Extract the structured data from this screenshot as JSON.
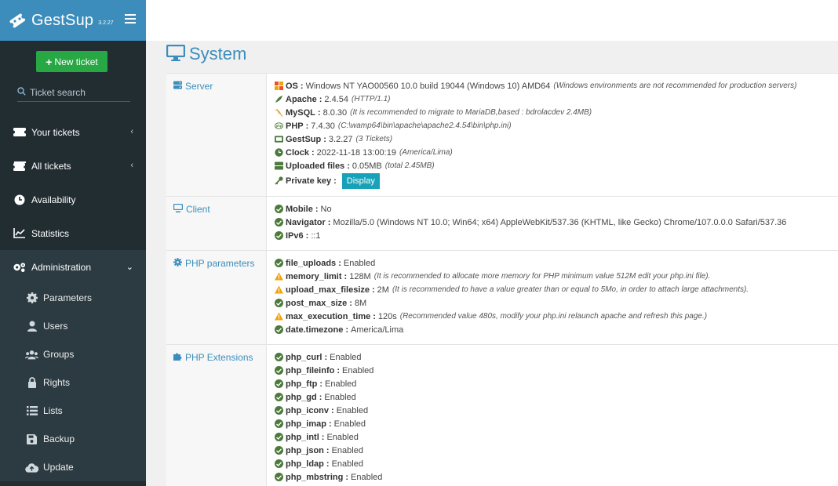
{
  "brand": {
    "name": "GestSup",
    "version": "3.2.27"
  },
  "sidebar": {
    "new_ticket": "New ticket",
    "search_placeholder": "Ticket search",
    "items": [
      {
        "label": "Your tickets",
        "icon": "ticket-icon",
        "chevron": "‹"
      },
      {
        "label": "All tickets",
        "icon": "tickets-icon",
        "chevron": "‹"
      },
      {
        "label": "Availability",
        "icon": "clock-icon"
      },
      {
        "label": "Statistics",
        "icon": "chart-icon"
      },
      {
        "label": "Administration",
        "icon": "cogs-icon",
        "chevron": "⌄"
      }
    ],
    "subitems": [
      {
        "label": "Parameters",
        "icon": "gear-icon"
      },
      {
        "label": "Users",
        "icon": "user-icon"
      },
      {
        "label": "Groups",
        "icon": "users-icon"
      },
      {
        "label": "Rights",
        "icon": "lock-icon"
      },
      {
        "label": "Lists",
        "icon": "list-icon"
      },
      {
        "label": "Backup",
        "icon": "save-icon"
      },
      {
        "label": "Update",
        "icon": "cloud-upload-icon"
      }
    ]
  },
  "page": {
    "title": "System"
  },
  "sections": {
    "server": {
      "label": "Server",
      "lines": [
        {
          "key": "OS",
          "value": "Windows NT YAO00560 10.0 build 19044 (Windows 10) AMD64",
          "note": "(Windows environments are not recommended for production servers)",
          "icon": "windows-icon"
        },
        {
          "key": "Apache",
          "value": "2.4.54",
          "note": "(HTTP/1.1)",
          "icon": "feather-icon"
        },
        {
          "key": "MySQL",
          "value": "8.0.30",
          "note": "(It is recommended to migrate to MariaDB,based : bdrolacdev 2.4MB)",
          "icon": "mysql-icon"
        },
        {
          "key": "PHP",
          "value": "7.4.30",
          "note": "(C:\\wamp64\\bin\\apache\\apache2.4.54\\bin\\php.ini)",
          "icon": "php-icon"
        },
        {
          "key": "GestSup",
          "value": "3.2.27",
          "note": "(3 Tickets)",
          "icon": "ticket-icon"
        },
        {
          "key": "Clock",
          "value": "2022-11-18 13:00:19",
          "note": "(America/Lima)",
          "icon": "clock-icon"
        },
        {
          "key": "Uploaded files",
          "value": "0.05MB",
          "note": "(total 2.45MB)",
          "icon": "hdd-icon"
        },
        {
          "key": "Private key",
          "value": "",
          "note": "",
          "icon": "key-icon",
          "button": "Display"
        }
      ]
    },
    "client": {
      "label": "Client",
      "lines": [
        {
          "key": "Mobile",
          "value": "No"
        },
        {
          "key": "Navigator",
          "value": "Mozilla/5.0 (Windows NT 10.0; Win64; x64) AppleWebKit/537.36 (KHTML, like Gecko) Chrome/107.0.0.0 Safari/537.36"
        },
        {
          "key": "IPv6",
          "value": "::1"
        }
      ]
    },
    "php_params": {
      "label": "PHP parameters",
      "lines": [
        {
          "key": "file_uploads",
          "value": "Enabled",
          "status": "ok",
          "note": ""
        },
        {
          "key": "memory_limit",
          "value": "128M",
          "status": "warn",
          "note": "(It is recommended to allocate more memory for PHP minimum value 512M edit your php.ini file)."
        },
        {
          "key": "upload_max_filesize",
          "value": "2M",
          "status": "warn",
          "note": "(It is recommended to have a value greater than or equal to 5Mo, in order to attach large attachments)."
        },
        {
          "key": "post_max_size",
          "value": "8M",
          "status": "ok",
          "note": ""
        },
        {
          "key": "max_execution_time",
          "value": "120s",
          "status": "warn",
          "note": "(Recommended value 480s, modify your php.ini relaunch apache and refresh this page.)"
        },
        {
          "key": "date.timezone",
          "value": "America/Lima",
          "status": "ok",
          "note": ""
        }
      ]
    },
    "php_ext": {
      "label": "PHP Extensions",
      "lines": [
        {
          "key": "php_curl",
          "value": "Enabled"
        },
        {
          "key": "php_fileinfo",
          "value": "Enabled"
        },
        {
          "key": "php_ftp",
          "value": "Enabled"
        },
        {
          "key": "php_gd",
          "value": "Enabled"
        },
        {
          "key": "php_iconv",
          "value": "Enabled"
        },
        {
          "key": "php_imap",
          "value": "Enabled"
        },
        {
          "key": "php_intl",
          "value": "Enabled"
        },
        {
          "key": "php_json",
          "value": "Enabled"
        },
        {
          "key": "php_ldap",
          "value": "Enabled"
        },
        {
          "key": "php_mbstring",
          "value": "Enabled"
        }
      ]
    }
  },
  "colors": {
    "accent": "#3c8dbc",
    "sidebar": "#222d32",
    "success": "#28a745",
    "ok": "#4b7a3b",
    "warn": "#f0a30a",
    "info": "#17a2b8"
  }
}
